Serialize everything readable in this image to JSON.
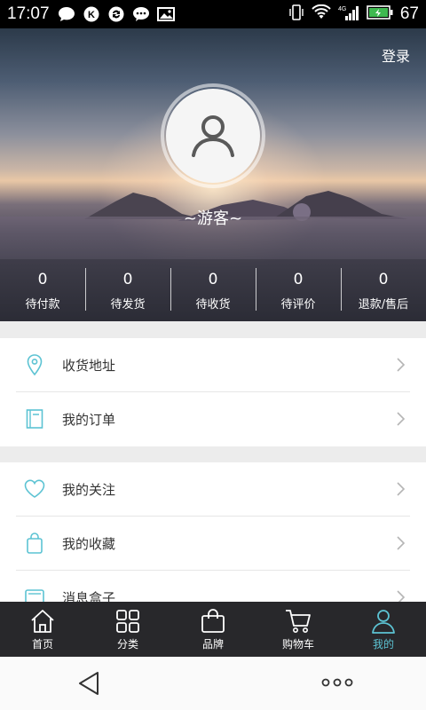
{
  "status_bar": {
    "time": "17:07",
    "icons": [
      "chat-bubble-icon",
      "k-circle-icon",
      "sync-icon",
      "message-icon",
      "image-icon"
    ],
    "signal": "4G",
    "battery": "67"
  },
  "header": {
    "login": "登录",
    "username": "~游客~",
    "order_stats": [
      {
        "count": "0",
        "label": "待付款"
      },
      {
        "count": "0",
        "label": "待发货"
      },
      {
        "count": "0",
        "label": "待收货"
      },
      {
        "count": "0",
        "label": "待评价"
      },
      {
        "count": "0",
        "label": "退款/售后"
      }
    ]
  },
  "menu": {
    "group1": [
      {
        "label": "收货地址",
        "icon": "location-pin-icon"
      },
      {
        "label": "我的订单",
        "icon": "order-book-icon"
      }
    ],
    "group2": [
      {
        "label": "我的关注",
        "icon": "heart-icon"
      },
      {
        "label": "我的收藏",
        "icon": "bag-icon"
      },
      {
        "label": "消息盒子",
        "icon": "message-box-icon"
      }
    ]
  },
  "tabs": [
    {
      "label": "首页",
      "icon": "home-icon"
    },
    {
      "label": "分类",
      "icon": "grid-icon"
    },
    {
      "label": "品牌",
      "icon": "shopping-bag-icon"
    },
    {
      "label": "购物车",
      "icon": "cart-icon"
    },
    {
      "label": "我的",
      "icon": "user-icon",
      "active": true
    }
  ],
  "colors": {
    "accent": "#5cc3d3",
    "tab_bar": "#28282b",
    "divider": "#e6e6e6"
  }
}
